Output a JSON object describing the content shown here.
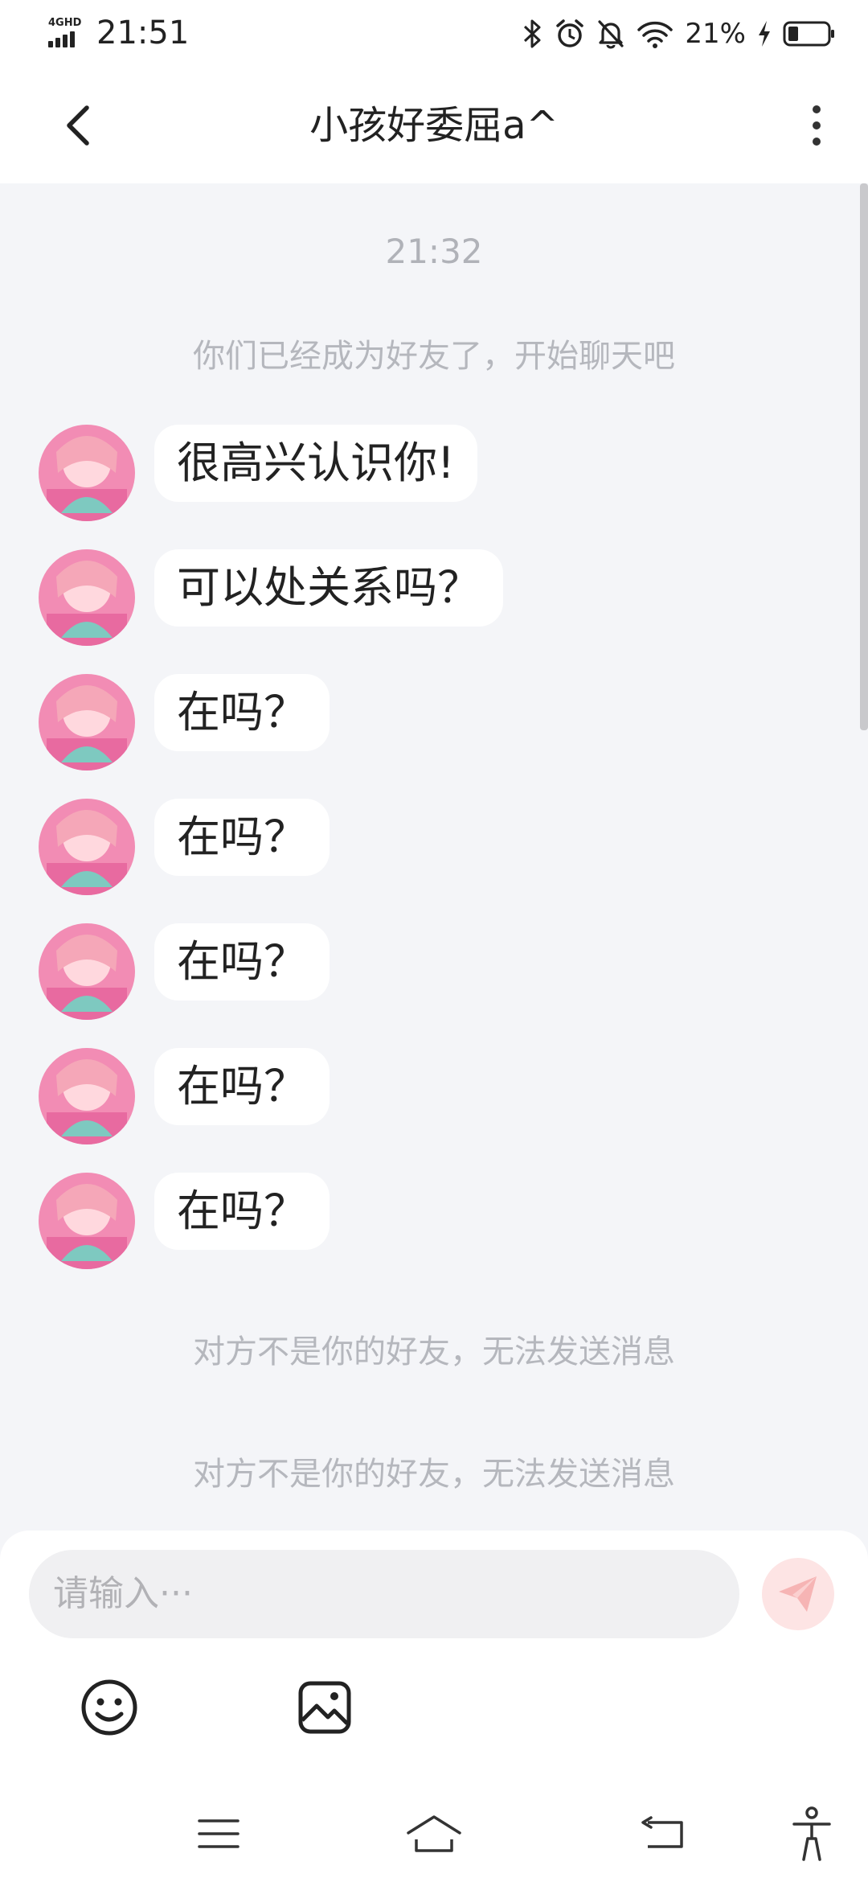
{
  "status_bar": {
    "network": "4GHD",
    "time": "21:51",
    "battery_percent": "21%",
    "icons": [
      "bluetooth-icon",
      "alarm-icon",
      "mute-icon",
      "wifi-icon",
      "charging-icon",
      "battery-icon"
    ]
  },
  "header": {
    "title": "小孩好委屈a^"
  },
  "chat": {
    "timestamp": "21:32",
    "system_friend_added": "你们已经成为好友了，开始聊天吧",
    "messages": [
      {
        "text": "很高兴认识你!"
      },
      {
        "text": "可以处关系吗？"
      },
      {
        "text": "在吗？"
      },
      {
        "text": "在吗？"
      },
      {
        "text": "在吗？"
      },
      {
        "text": "在吗？"
      },
      {
        "text": "在吗？"
      }
    ],
    "system_errors": [
      "对方不是你的好友，无法发送消息",
      "对方不是你的好友，无法发送消息"
    ]
  },
  "composer": {
    "placeholder": "请输入···"
  },
  "colors": {
    "background": "#f4f5f8",
    "bubble": "#ffffff",
    "send_button": "#fde4e4",
    "send_icon": "#f6b4b4",
    "system_text": "#b5b7bd"
  }
}
